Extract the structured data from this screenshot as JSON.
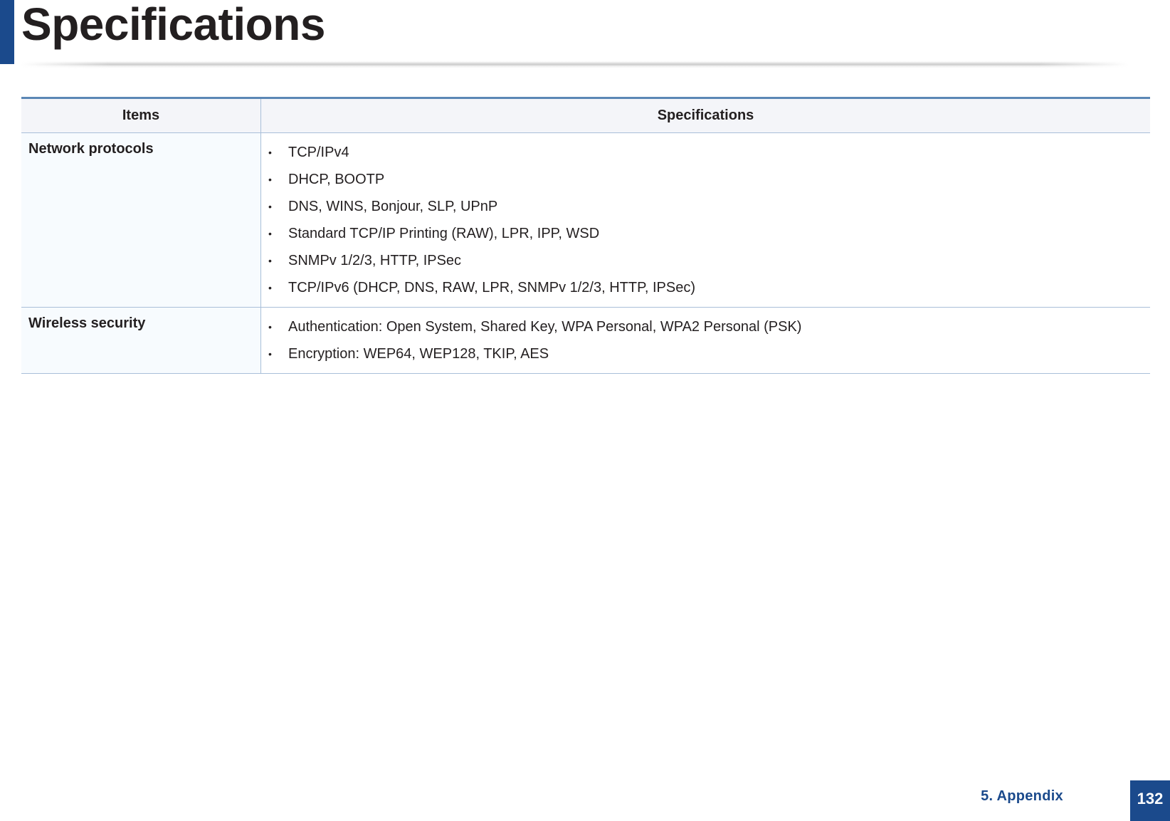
{
  "page": {
    "title": "Specifications",
    "accent_color": "#1b4a8c"
  },
  "table": {
    "headers": {
      "items": "Items",
      "specifications": "Specifications"
    },
    "rows": [
      {
        "item": "Network protocols",
        "specs": [
          "TCP/IPv4",
          "DHCP, BOOTP",
          "DNS, WINS, Bonjour, SLP, UPnP",
          "Standard TCP/IP Printing (RAW), LPR, IPP, WSD",
          "SNMPv 1/2/3, HTTP, IPSec",
          "TCP/IPv6 (DHCP, DNS, RAW, LPR, SNMPv 1/2/3, HTTP, IPSec)"
        ]
      },
      {
        "item": "Wireless security",
        "specs": [
          "Authentication: Open System, Shared Key, WPA Personal, WPA2 Personal (PSK)",
          "Encryption: WEP64, WEP128, TKIP, AES"
        ]
      }
    ]
  },
  "footer": {
    "section": "5.  Appendix",
    "page_number": "132"
  }
}
